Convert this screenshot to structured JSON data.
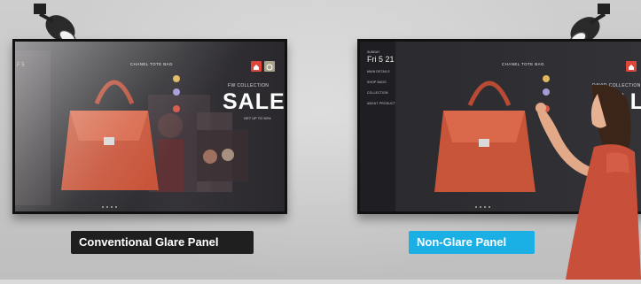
{
  "labels": {
    "left": "Conventional Glare Panel",
    "right": "Non-Glare Panel"
  },
  "left_screen": {
    "header": "CHANEL TOTE BAG",
    "tag_small": "FW COLLECTION",
    "sale": "SALE",
    "subtext": "GET UP TO 50%",
    "edge_text": "F 5"
  },
  "right_screen": {
    "header": "CHANEL TOTE BAG",
    "date_top": "SUNDAY",
    "date_big": "Fri 5 21",
    "sale_small": "DAVID COLLECTION",
    "sale_partial": "SAL",
    "menu": [
      "MAIN DETAILS",
      "SHOP BAGS",
      "COLLECTION",
      "ABOUT PRODUCT"
    ]
  },
  "colors": {
    "label_left_bg": "#1f1f1f",
    "label_right_bg": "#1ab0e6",
    "bag": "#c8553a",
    "accent_red": "#e0453a"
  }
}
